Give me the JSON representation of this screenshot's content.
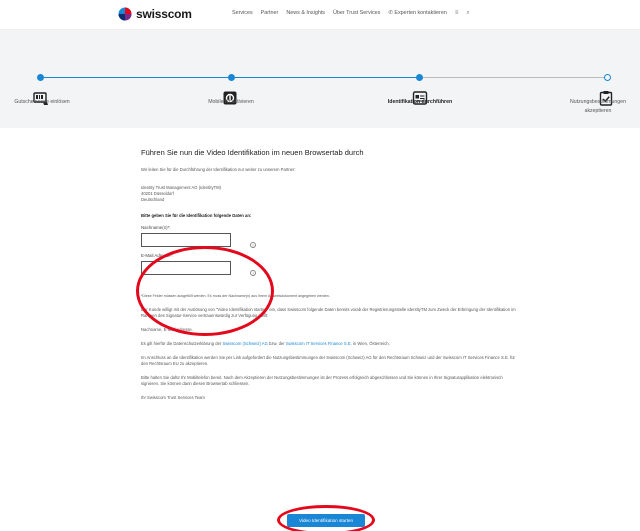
{
  "header": {
    "brand": "swisscom",
    "nav": [
      "Services",
      "Partner",
      "News & Insights",
      "Über Trust Services",
      "Experten kontaktieren"
    ],
    "nav_icon_glyph": "⌕"
  },
  "steps": [
    {
      "label": "Gutscheincode einlösen",
      "icon": "voucher-card-icon",
      "state": "done"
    },
    {
      "label": "Mobile ID aktivieren",
      "icon": "mobile-id-icon",
      "state": "done"
    },
    {
      "label": "Identifikation durchführen",
      "icon": "id-card-icon",
      "state": "active"
    },
    {
      "label": "Nutzungsbestimmungen akzeptieren",
      "icon": "clipboard-check-icon",
      "state": "todo"
    }
  ],
  "content": {
    "heading": "Führen Sie nun die Video Identifikation im neuen Browsertab durch",
    "intro": "Wir leiten Sie für die Durchführung der Identifikation nur weiter zu unserem Partner:",
    "address_line1": "Identity Trust Management AG (IdentityTM)",
    "address_line2": "40201 Düsseldorf",
    "address_line3": "Deutschland",
    "instruction": "Bitte geben Sie für die Identifikation folgende Daten an:",
    "field1_label": "Nachname(n)*:",
    "field1_value": "",
    "field2_label": "E-Mail Adresse*:",
    "field2_value": "",
    "required_note": "*Diese Felder müssen ausgefüllt werden. Es muss der Nachname(n) aus ihrem Ausweisdokument angegeben werden.",
    "consent_text": "Der Kunde willigt mit der Auslösung von \"Video Identifikation starten\" ein, dass Swisscom folgende Daten bereits vorab der Registrierungsstelle IdentityTM zum Zweck der Erbringung der Identifikation im Rahmen des Signatur-Service vertrauenswürdig zur Verfügung stellt:",
    "data_items": "Nachname, E-Mail Adresse.",
    "privacy_prefix": "Es gilt hierfür die Datenschutzerklärung der",
    "privacy_link1": "Swisscom (Schweiz) AG",
    "privacy_middle": "bzw. der",
    "privacy_link2": "Swisscom IT Services Finance S.E.",
    "privacy_suffix": "in Wien, Österreich.",
    "terms_text": "Im Anschluss an die Identifikation werden Sie per Link aufgefordert die Nutzungsbestimmungen der Swisscom (Schweiz) AG für den Rechtsraum Schweiz und der Swisscom IT Services Finance S.E. für den Rechtsraum EU zu akzeptieren.",
    "mobile_text": "Bitte halten Sie dafür Ihr Mobiltelefon bereit. Nach dem Akzeptieren der Nutzungsbestimmungen ist der Prozess erfolgreich abgeschlossen und Sie können in Ihrer Signaturapplikation elektronisch signieren. Sie können dann diesen Browsertab schliessen.",
    "signoff": "Ihr Swisscom Trust Services Team",
    "cta_label": "Video Identifikation starten"
  },
  "colors": {
    "accent": "#1a87d6",
    "annotation": "#e3081b"
  }
}
